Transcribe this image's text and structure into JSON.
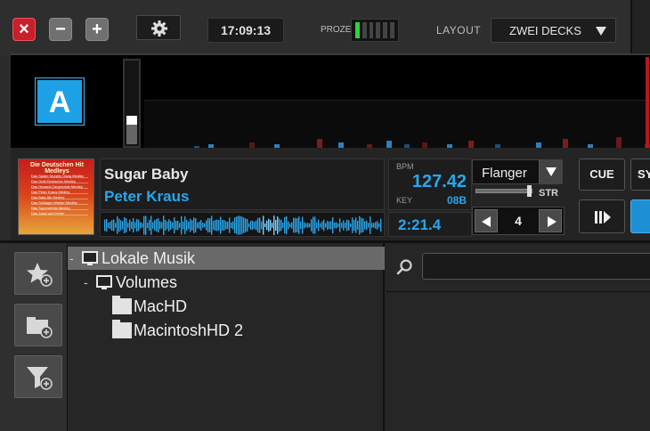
{
  "window": {
    "close_label": "×",
    "minimize_label": "−",
    "maximize_label": "+"
  },
  "toolbar": {
    "settings_icon": "gear-icon",
    "clock": "17:09:13",
    "cpu_meter_label": "PROZE",
    "cpu_meter_segments_on": 1,
    "cpu_meter_segments_total": 6,
    "layout_label": "LAYOUT",
    "layout_value": "ZWEI DECKS"
  },
  "deck": {
    "badge": "A",
    "track_title": "Sugar Baby",
    "track_artist": "Peter Kraus",
    "cover": {
      "title": "Die Deutschen Hit Medleys",
      "lines": [
        "Das Spider Murphy Gang Medley",
        "Das Drafi Deutscher Medley",
        "Das Howard Carpendale Medley",
        "Das Peter Kraus Medley",
        "Das Bata Illic Medley",
        "Das Schlager Wieder Medley",
        "Das Sommerhits Medley",
        "Das Jubel und Heiter"
      ]
    },
    "bpm_label": "BPM",
    "bpm_value": "127.42",
    "key_label": "KEY",
    "key_value": "08B",
    "time_remaining": "2:21.4",
    "effect": "Flanger",
    "str_label": "STR",
    "loop_value": "4",
    "cue_label": "CUE",
    "sync_label": "SY",
    "colors": {
      "accent": "#26a8ee",
      "badge": "#1ea0e6",
      "close": "#c8202a",
      "meter_on": "#2ad43a"
    }
  },
  "browser": {
    "sidebar_icons": [
      "star-add-icon",
      "folder-add-icon",
      "filter-add-icon"
    ],
    "tree": [
      {
        "label": "Lokale Musik",
        "icon": "monitor-icon",
        "expander": "-",
        "selected": true,
        "level": 0
      },
      {
        "label": "Volumes",
        "icon": "monitor-icon",
        "expander": "-",
        "selected": false,
        "level": 1
      },
      {
        "label": "MacHD",
        "icon": "folder-icon",
        "expander": "",
        "selected": false,
        "level": 2
      },
      {
        "label": "MacintoshHD 2",
        "icon": "folder-icon",
        "expander": "",
        "selected": false,
        "level": 2
      }
    ],
    "search_placeholder": ""
  }
}
